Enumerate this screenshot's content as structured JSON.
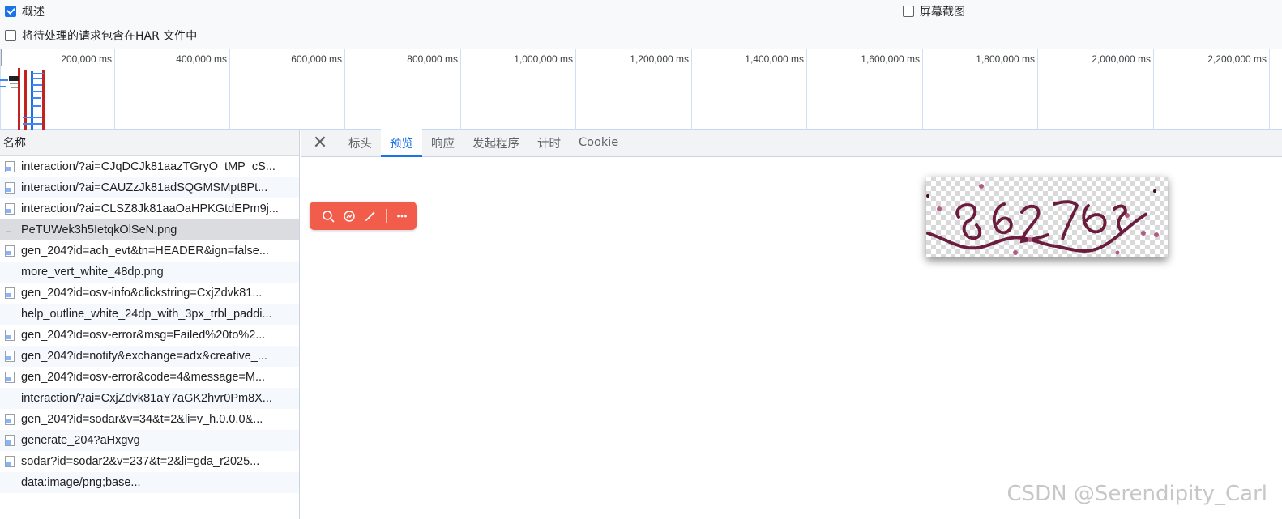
{
  "options": {
    "overview": {
      "label": "概述",
      "checked": true
    },
    "include_har": {
      "label": "将待处理的请求包含在HAR 文件中",
      "checked": false
    },
    "screenshots": {
      "label": "屏幕截图",
      "checked": false
    }
  },
  "timeline": {
    "ticks": [
      "200,000 ms",
      "400,000 ms",
      "600,000 ms",
      "800,000 ms",
      "1,000,000 ms",
      "1,200,000 ms",
      "1,400,000 ms",
      "1,600,000 ms",
      "1,800,000 ms",
      "2,000,000 ms",
      "2,200,000 ms"
    ]
  },
  "request_list": {
    "header": "名称",
    "rows": [
      {
        "name": "interaction/?ai=CJqDCJk81aazTGryO_tMP_cS...",
        "icon": "doc"
      },
      {
        "name": "interaction/?ai=CAUZzJk81adSQGMSMpt8Pt...",
        "icon": "doc"
      },
      {
        "name": "interaction/?ai=CLSZ8Jk81aaOaHPKGtdEPm9j...",
        "icon": "doc"
      },
      {
        "name": "PeTUWek3h5IetqkOlSeN.png",
        "icon": "img"
      },
      {
        "name": "gen_204?id=ach_evt&tn=HEADER&ign=false...",
        "icon": "doc"
      },
      {
        "name": "more_vert_white_48dp.png",
        "icon": "none"
      },
      {
        "name": "gen_204?id=osv-info&clickstring=CxjZdvk81...",
        "icon": "doc"
      },
      {
        "name": "help_outline_white_24dp_with_3px_trbl_paddi...",
        "icon": "none"
      },
      {
        "name": "gen_204?id=osv-error&msg=Failed%20to%2...",
        "icon": "doc"
      },
      {
        "name": "gen_204?id=notify&exchange=adx&creative_...",
        "icon": "doc"
      },
      {
        "name": "gen_204?id=osv-error&code=4&message=M...",
        "icon": "doc"
      },
      {
        "name": "interaction/?ai=CxjZdvk81aY7aGK2hvr0Pm8X...",
        "icon": "none"
      },
      {
        "name": "gen_204?id=sodar&v=34&t=2&li=v_h.0.0.0&...",
        "icon": "doc"
      },
      {
        "name": "generate_204?aHxgvg",
        "icon": "doc"
      },
      {
        "name": "sodar?id=sodar2&v=237&t=2&li=gda_r2025...",
        "icon": "doc"
      },
      {
        "name": "data:image/png;base...",
        "icon": "none"
      }
    ],
    "selected_index": 3
  },
  "detail": {
    "tabs": [
      "标头",
      "预览",
      "响应",
      "发起程序",
      "计时",
      "Cookie"
    ],
    "active_tab": "预览",
    "preview_icon": "captcha-image"
  },
  "float_toolbar": {
    "icons": [
      "search-icon",
      "image-search-icon",
      "magic-wand-icon",
      "more-icon"
    ],
    "color": "#f25c4b"
  },
  "watermark": "CSDN @Serendipity_Carl",
  "colors": {
    "accent": "#1a73e8",
    "selected_row": "#dadce0"
  }
}
